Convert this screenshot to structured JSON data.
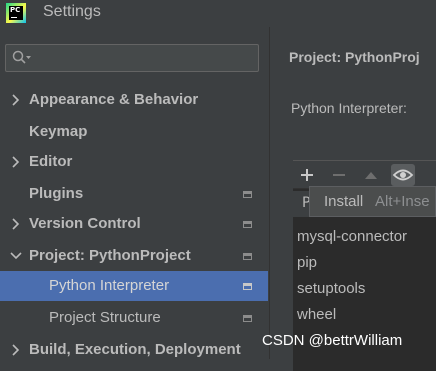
{
  "window": {
    "title": "Settings",
    "logo_text": "PC"
  },
  "search": {
    "value": "",
    "placeholder": ""
  },
  "tree": {
    "appearance": "Appearance & Behavior",
    "keymap": "Keymap",
    "editor": "Editor",
    "plugins": "Plugins",
    "version_control": "Version Control",
    "project": "Project: PythonProject",
    "python_interpreter": "Python Interpreter",
    "project_structure": "Project Structure",
    "build": "Build, Execution, Deployment"
  },
  "main": {
    "title": "Project: PythonProj",
    "interpreter_label": "Python Interpreter:",
    "table_header": "P",
    "packages": [
      "mysql-connector",
      "pip",
      "setuptools",
      "wheel"
    ]
  },
  "tooltip": {
    "label": "Install",
    "shortcut": "Alt+Inse"
  },
  "watermark": "CSDN @bettrWilliam",
  "colors": {
    "selection": "#4b6eaf",
    "background": "#3c3f41",
    "table_bg": "#2b2b2b"
  }
}
